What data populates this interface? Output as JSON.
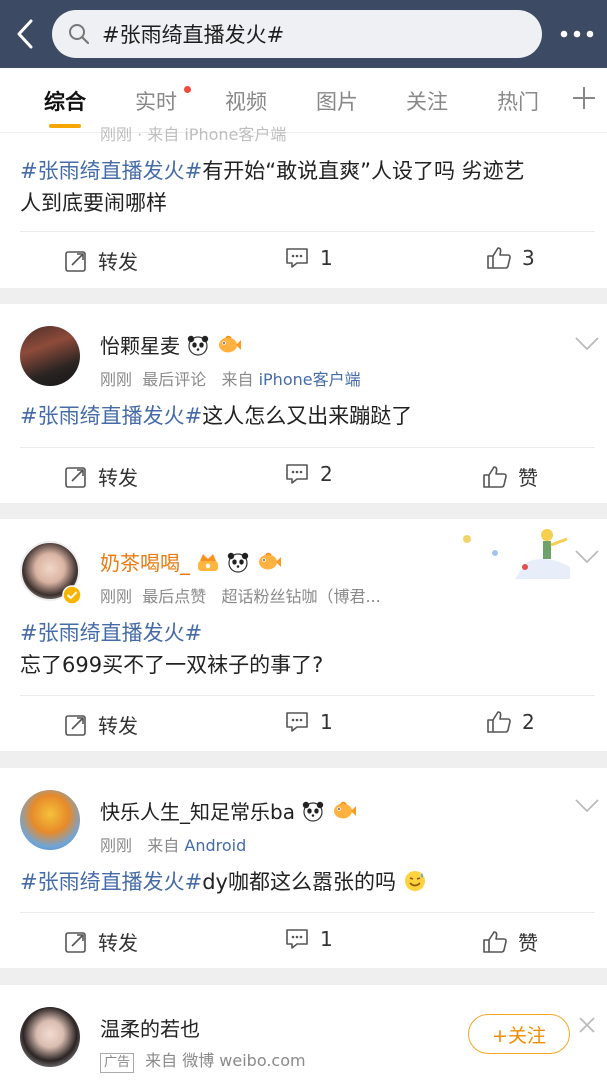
{
  "header": {
    "search_query": "#张雨绮直播发火#"
  },
  "tabs": [
    {
      "label": "综合"
    },
    {
      "label": "实时"
    },
    {
      "label": "视频"
    },
    {
      "label": "图片"
    },
    {
      "label": "关注"
    },
    {
      "label": "热门"
    }
  ],
  "posts": [
    {
      "meta_partial": "刚刚 · 来自 iPhone客户端",
      "hashtag": "#张雨绮直播发火#",
      "text_line1": "有开始“敢说直爽”人设了吗 劣迹艺",
      "text_line2": "人到底要闹哪样",
      "repost": "转发",
      "comments": "1",
      "likes": "3"
    },
    {
      "username": "怡颗星麦",
      "meta_time": "刚刚",
      "meta_action": "最后评论",
      "meta_from": "来自",
      "meta_source": "iPhone客户端",
      "hashtag": "#张雨绮直播发火#",
      "text": "这人怎么又出来蹦跶了",
      "repost": "转发",
      "comments": "2",
      "likes": "赞"
    },
    {
      "username": "奶茶喝喝_",
      "meta_time": "刚刚",
      "meta_action": "最后点赞",
      "meta_extra": "超话粉丝钻咖（博君...",
      "hashtag": "#张雨绮直播发火#",
      "text": "忘了699买不了一双袜子的事了?",
      "repost": "转发",
      "comments": "1",
      "likes": "2"
    },
    {
      "username": "快乐人生_知足常乐ba",
      "meta_time": "刚刚",
      "meta_from": "来自",
      "meta_source": "Android",
      "hashtag": "#张雨绮直播发火#",
      "text": "dy咖都这么嚣张的吗",
      "repost": "转发",
      "comments": "1",
      "likes": "赞"
    },
    {
      "username": "温柔的若也",
      "ad_tag": "广告",
      "meta_from": "来自",
      "meta_source": "微博 weibo.com",
      "follow_label": "+关注"
    }
  ],
  "colors": {
    "header_bg": "#3c4a63",
    "hashtag": "#456ba8",
    "accent_orange": "#f7a500",
    "username_orange": "#e97a12"
  }
}
